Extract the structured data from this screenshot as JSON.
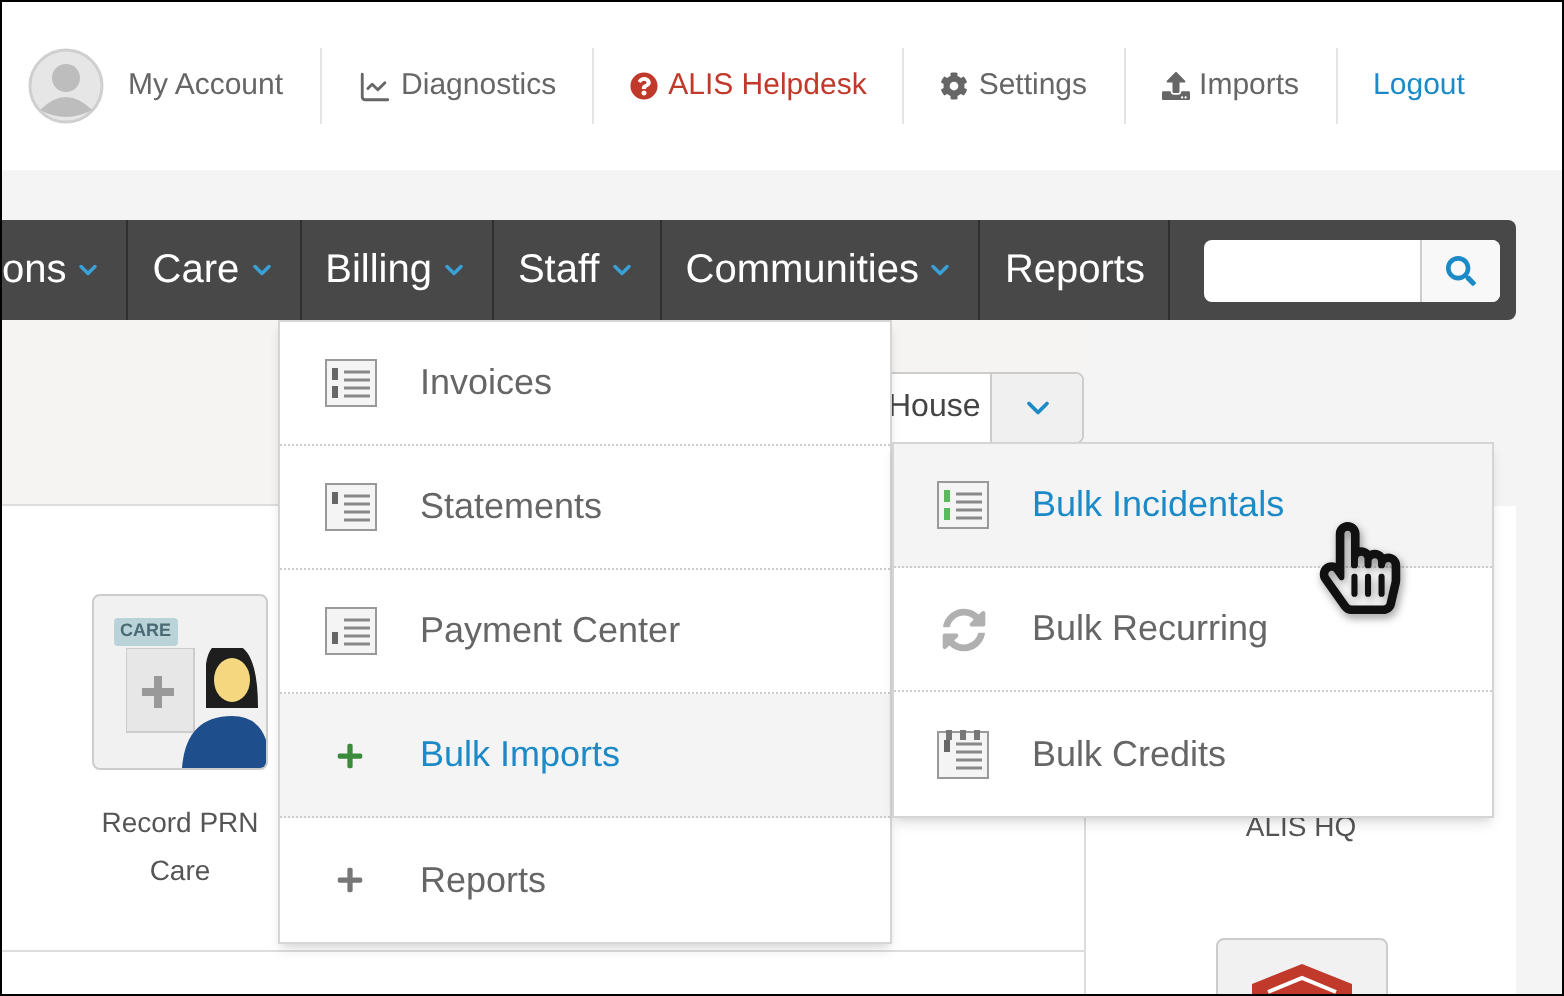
{
  "header": {
    "links": [
      {
        "kind": "account",
        "label": "My Account"
      },
      {
        "kind": "diagnostics",
        "label": "Diagnostics"
      },
      {
        "kind": "helpdesk",
        "label": "ALIS Helpdesk"
      },
      {
        "kind": "settings",
        "label": "Settings"
      },
      {
        "kind": "imports",
        "label": "Imports"
      },
      {
        "kind": "logout",
        "label": "Logout"
      }
    ]
  },
  "nav": {
    "items": [
      {
        "label": "ons",
        "caret": true
      },
      {
        "label": "Care",
        "caret": true
      },
      {
        "label": "Billing",
        "caret": true
      },
      {
        "label": "Staff",
        "caret": true
      },
      {
        "label": "Communities",
        "caret": true
      },
      {
        "label": "Reports",
        "caret": false
      }
    ]
  },
  "billing_menu": {
    "items": [
      {
        "kind": "invoice",
        "label": "Invoices",
        "selected": false
      },
      {
        "kind": "statement",
        "label": "Statements",
        "selected": false
      },
      {
        "kind": "payment",
        "label": "Payment Center",
        "selected": false
      },
      {
        "kind": "plus",
        "label": "Bulk Imports",
        "selected": true
      },
      {
        "kind": "plus",
        "label": "Reports",
        "selected": false
      }
    ]
  },
  "submenu": {
    "items": [
      {
        "kind": "incidentals",
        "label": "Bulk Incidentals",
        "selected": true
      },
      {
        "kind": "recurring",
        "label": "Bulk Recurring",
        "selected": false
      },
      {
        "kind": "credits",
        "label": "Bulk Credits",
        "selected": false
      }
    ]
  },
  "community_select": {
    "value": "House"
  },
  "tiles": [
    {
      "badge": "CARE",
      "label": "Record PRN Care"
    }
  ],
  "right_panel": {
    "label": "ALIS HQ"
  }
}
